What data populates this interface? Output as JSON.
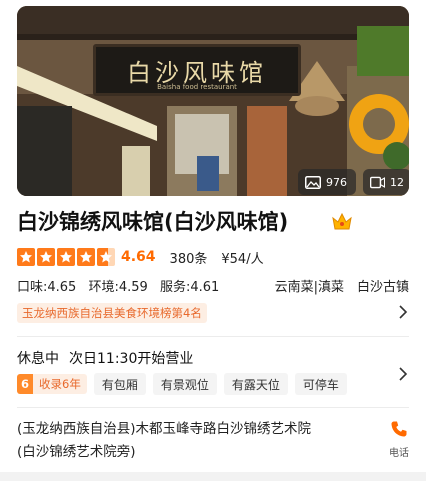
{
  "hero": {
    "sign_title": "白沙风味馆",
    "sign_subtitle": "Baisha food restaurant",
    "photo_count": "976",
    "video_count": "12"
  },
  "shop": {
    "name": "白沙锦绣风味馆(白沙风味馆)",
    "rating": 4.5,
    "score": "4.64",
    "reviews": "380条",
    "price": "¥54/人",
    "sub_scores": [
      "口味:4.65",
      "环境:4.59",
      "服务:4.61"
    ],
    "cuisine": "云南菜|滇菜",
    "area": "白沙古镇",
    "ranking": "玉龙纳西族自治县美食环境榜第4名"
  },
  "status": {
    "state": "休息中",
    "next_open": "次日11:30开始营业",
    "years_num": "6",
    "years_text": "收录6年",
    "features": [
      "有包厢",
      "有景观位",
      "有露天位",
      "可停车"
    ]
  },
  "address": {
    "line1": "(玉龙纳西族自治县)木都玉峰寺路白沙锦绣艺术院",
    "line2": "(白沙锦绣艺术院旁)",
    "phone_label": "电话"
  },
  "colors": {
    "accent": "#ff6a00",
    "star": "#ff7a1a",
    "tag_bg": "#fdeee3",
    "tag_text": "#e8692c"
  }
}
